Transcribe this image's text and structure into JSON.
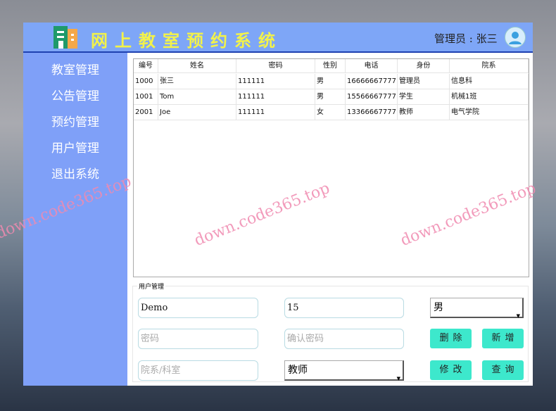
{
  "header": {
    "title": "网上教室预约系统",
    "admin_label": "管理员 : 张三"
  },
  "sidebar": {
    "items": [
      {
        "label": "教室管理"
      },
      {
        "label": "公告管理"
      },
      {
        "label": "预约管理"
      },
      {
        "label": "用户管理"
      },
      {
        "label": "退出系统"
      }
    ]
  },
  "table": {
    "columns": [
      "编号",
      "姓名",
      "密码",
      "性别",
      "电话",
      "身份",
      "院系"
    ],
    "rows": [
      [
        "1000",
        "张三",
        "111111",
        "男",
        "16666667777",
        "管理员",
        "信息科"
      ],
      [
        "1001",
        "Tom",
        "111111",
        "男",
        "15566667777",
        "学生",
        "机械1班"
      ],
      [
        "2001",
        "Joe",
        "111111",
        "女",
        "13366667777",
        "教师",
        "电气学院"
      ]
    ]
  },
  "form": {
    "group_label": "用户管理",
    "name_value": "Demo",
    "phone_value": "15",
    "gender_selected": "男",
    "password_placeholder": "密码",
    "confirm_placeholder": "确认密码",
    "dept_placeholder": "院系/科室",
    "role_selected": "教师",
    "delete_label": "删除",
    "add_label": "新增",
    "edit_label": "修改",
    "query_label": "查询"
  },
  "watermark": "down.code365.top"
}
